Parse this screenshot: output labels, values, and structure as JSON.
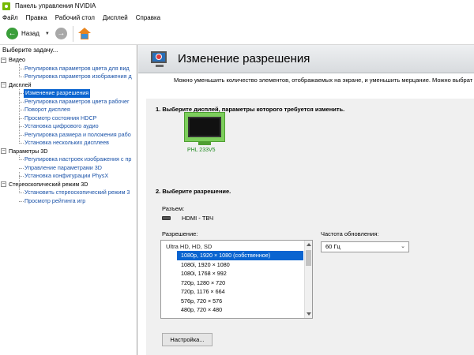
{
  "window": {
    "title": "Панель управления NVIDIA"
  },
  "menu": [
    "Файл",
    "Правка",
    "Рабочий стол",
    "Дисплей",
    "Справка"
  ],
  "toolbar": {
    "back_label": "Назад"
  },
  "sidebar": {
    "header": "Выберите задачу...",
    "categories": [
      {
        "label": "Видео",
        "items": [
          "Регулировка параметров цвета для вид",
          "Регулировка параметров изображения д"
        ]
      },
      {
        "label": "Дисплей",
        "items": [
          "Изменение разрешения",
          "Регулировка параметров цвета рабочег",
          "Поворот дисплея",
          "Просмотр состояния HDCP",
          "Установка цифрового аудио",
          "Регулировка размера и положения рабо",
          "Установка нескольких дисплеев"
        ]
      },
      {
        "label": "Параметры 3D",
        "items": [
          "Регулировка настроек изображения с пр",
          "Управление параметрами 3D",
          "Установка конфигурации PhysX"
        ]
      },
      {
        "label": "Стереоскопический режим 3D",
        "items": [
          "Установить стереоскопический режим 3",
          "Просмотр рейтинга игр"
        ]
      }
    ],
    "selected": "Изменение разрешения"
  },
  "page": {
    "title": "Изменение разрешения",
    "description": "Можно уменьшить количество элементов, отображаемых на экране, и уменьшить мерцание. Можно выбрат",
    "step1": "1. Выберите дисплей, параметры которого требуется изменить.",
    "monitor_name": "PHL 233V5",
    "step2": "2. Выберите разрешение.",
    "connector_label": "Разъем:",
    "connector_value": "HDMI - ТВЧ",
    "resolution_label": "Разрешение:",
    "refresh_label": "Частота обновления:",
    "refresh_value": "60 Гц",
    "resolution_group": "Ultra HD, HD, SD",
    "resolutions": [
      "1080p, 1920 × 1080 (собственное)",
      "1080i, 1920 × 1080",
      "1080i, 1768 × 992",
      "720p, 1280 × 720",
      "720p, 1176 × 664",
      "576p, 720 × 576",
      "480p, 720 × 480"
    ],
    "selected_resolution": "1080p, 1920 × 1080 (собственное)",
    "settings_button": "Настройка..."
  }
}
